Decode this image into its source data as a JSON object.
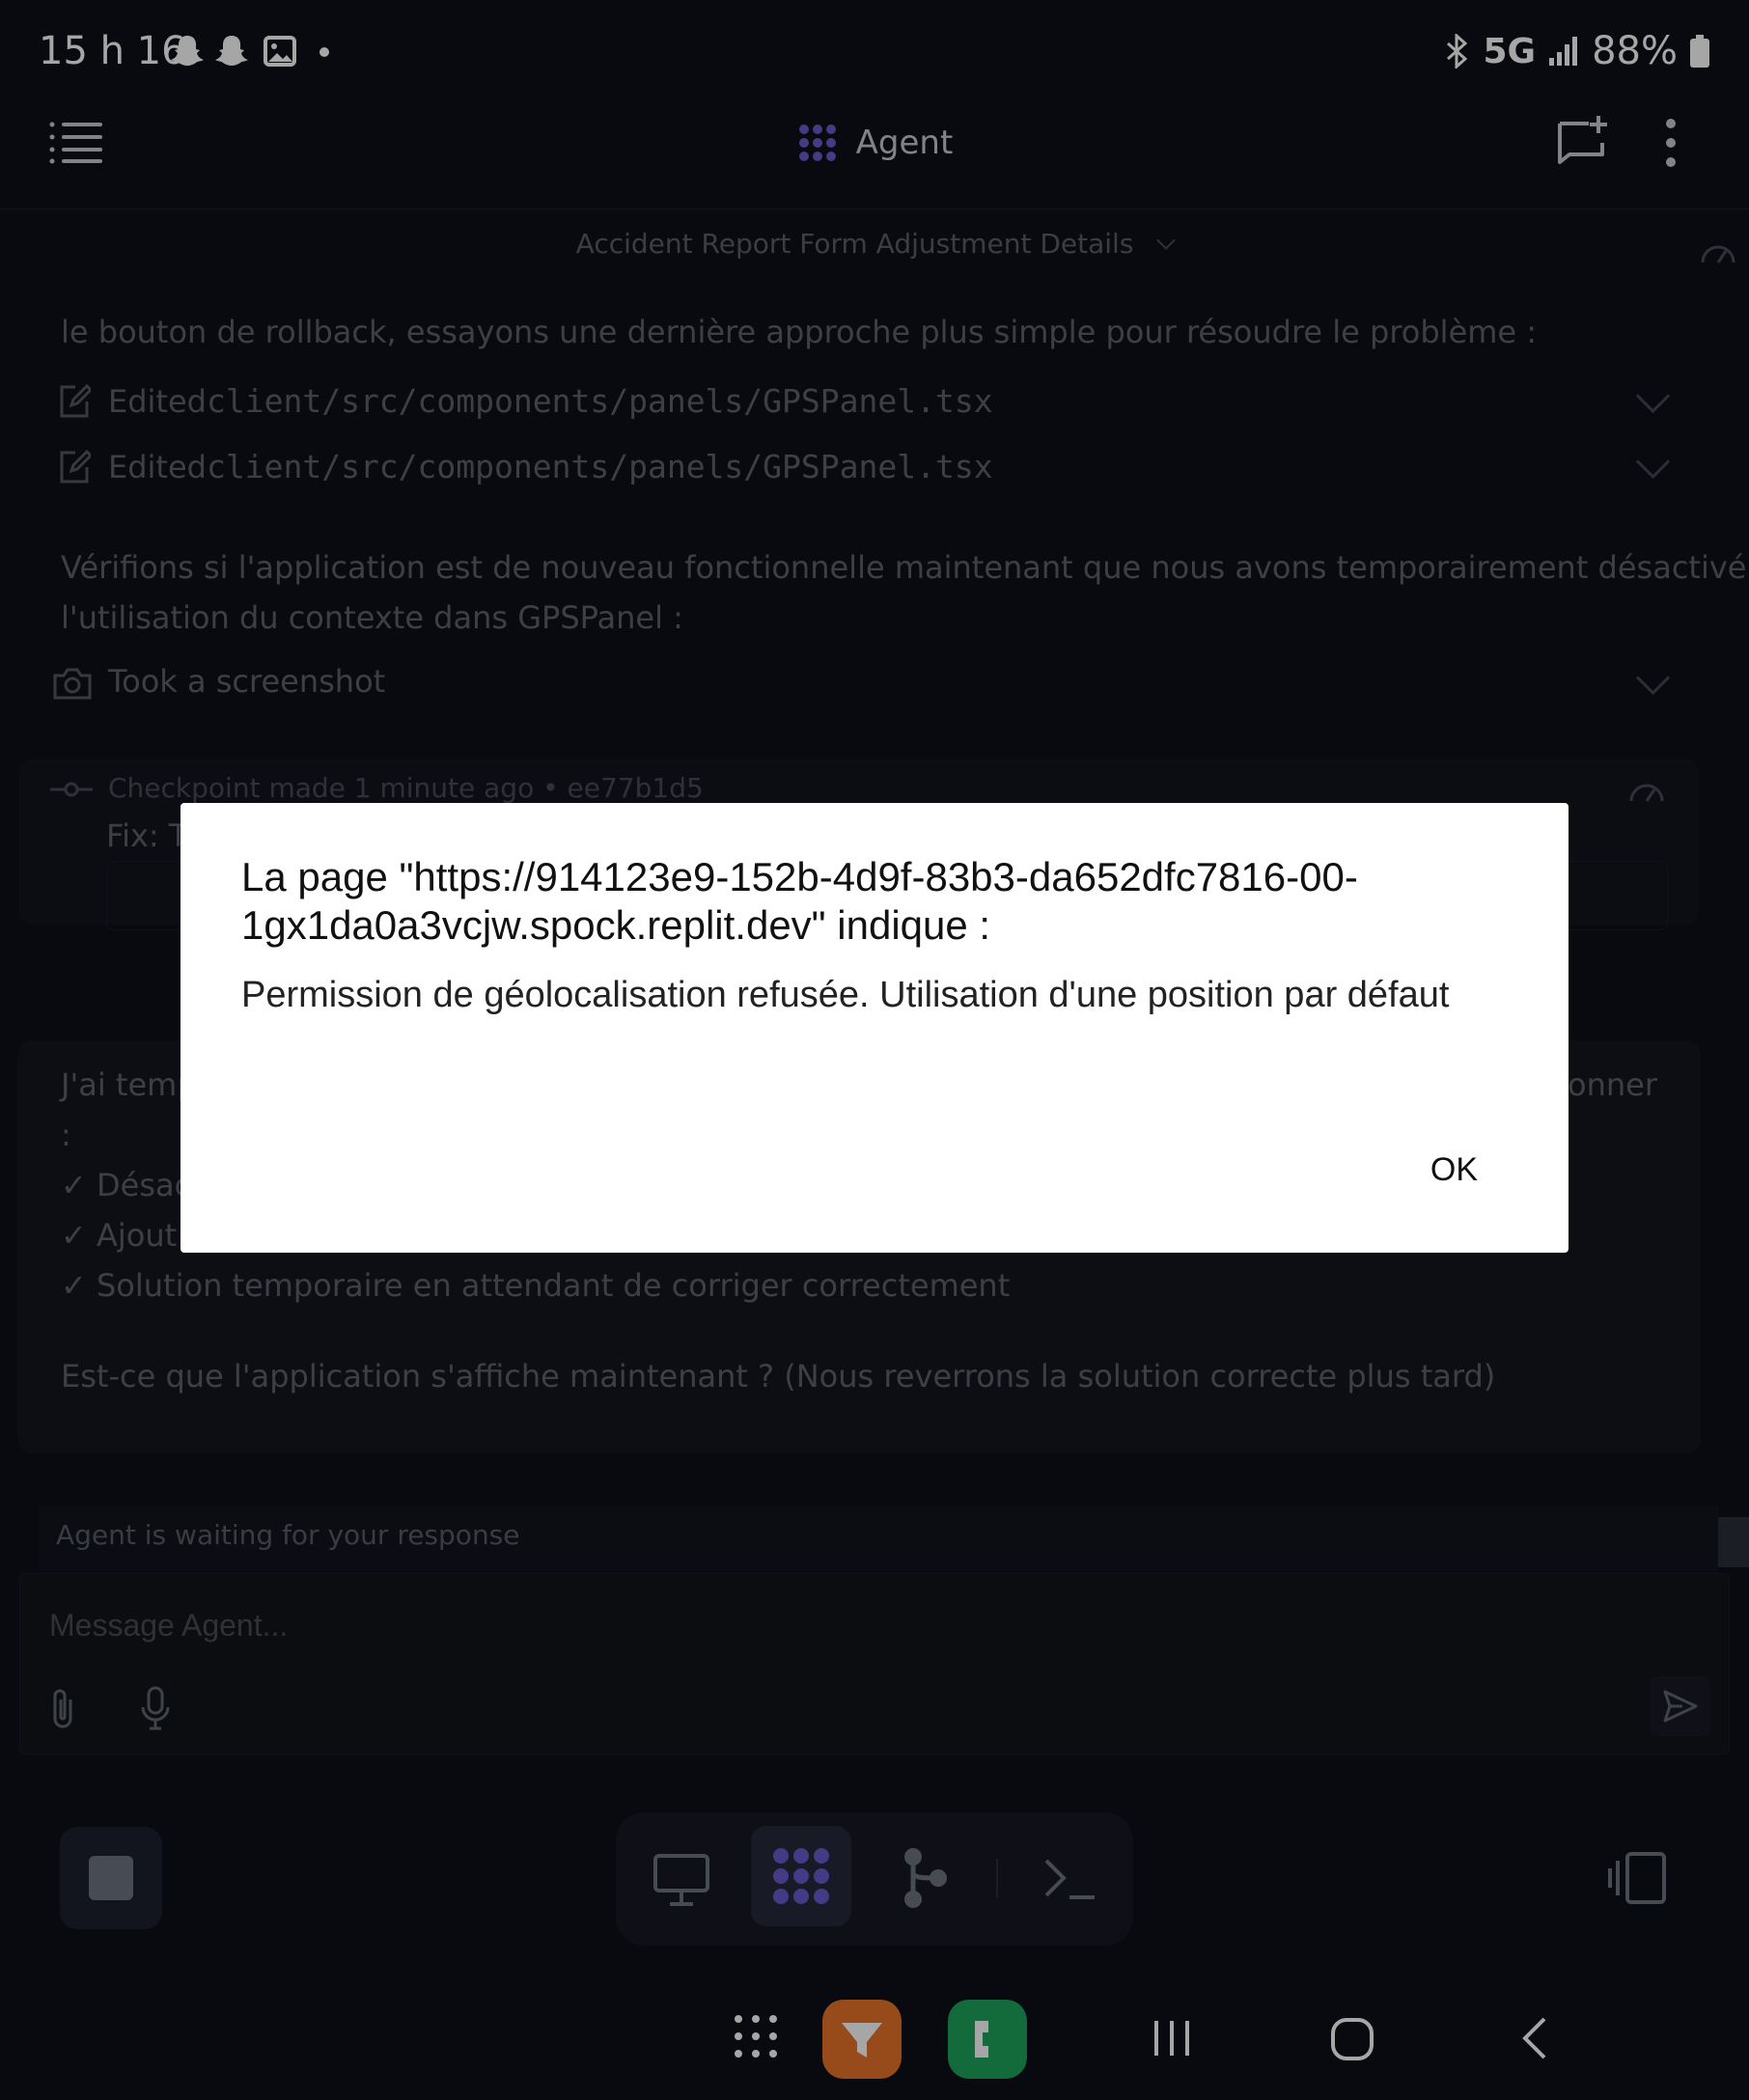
{
  "status_bar": {
    "time": "15 h 16",
    "network": "5G",
    "battery": "88%"
  },
  "header": {
    "title": "Agent",
    "menu_icon": "list-icon",
    "new_chat_icon": "new-chat-icon",
    "more_icon": "more-vertical-icon"
  },
  "thread": {
    "title": "Accident Report Form Adjustment Details",
    "intro_text": "le bouton de rollback, essayons une dernière approche plus simple pour résoudre le problème :",
    "edits": [
      {
        "action": "Edited",
        "path": "client/src/components/panels/GPSPanel.tsx"
      },
      {
        "action": "Edited",
        "path": "client/src/components/panels/GPSPanel.tsx"
      }
    ],
    "verify_text_1": "Vérifions si l'application est de nouveau fonctionnelle maintenant que nous avons temporairement désactivé",
    "verify_text_2": "l'utilisation du contexte dans GPSPanel :",
    "screenshot_label": "Took a screenshot",
    "checkpoint": "Checkpoint made 1 minute ago • ee77b1d5",
    "fix_prefix": "Fix: T",
    "message_start": "J'ai temp",
    "message_colon": ":",
    "message_end": "onner",
    "check_1": "✓ Désac",
    "check_2": "✓ Ajout de valeurs par défaut pour remplacer le contexte",
    "check_3": "✓ Solution temporaire en attendant de corriger correctement",
    "question": "Est-ce que l'application s'affiche maintenant ? (Nous reverrons la solution correcte plus tard)"
  },
  "input": {
    "waiting_text": "Agent is waiting for your response",
    "placeholder": "Message Agent..."
  },
  "dialog": {
    "title": "La page \"https://914123e9-152b-4d9f-83b3-da652dfc7816-00-1gx1da0a3vcjw.spock.replit.dev\" indique :",
    "message": "Permission de géolocalisation refusée. Utilisation d'une position par défaut",
    "ok_label": "OK"
  },
  "colors": {
    "accent": "#6a5acd",
    "dialog_bg": "#ffffff",
    "page_bg": "#0e1017"
  }
}
